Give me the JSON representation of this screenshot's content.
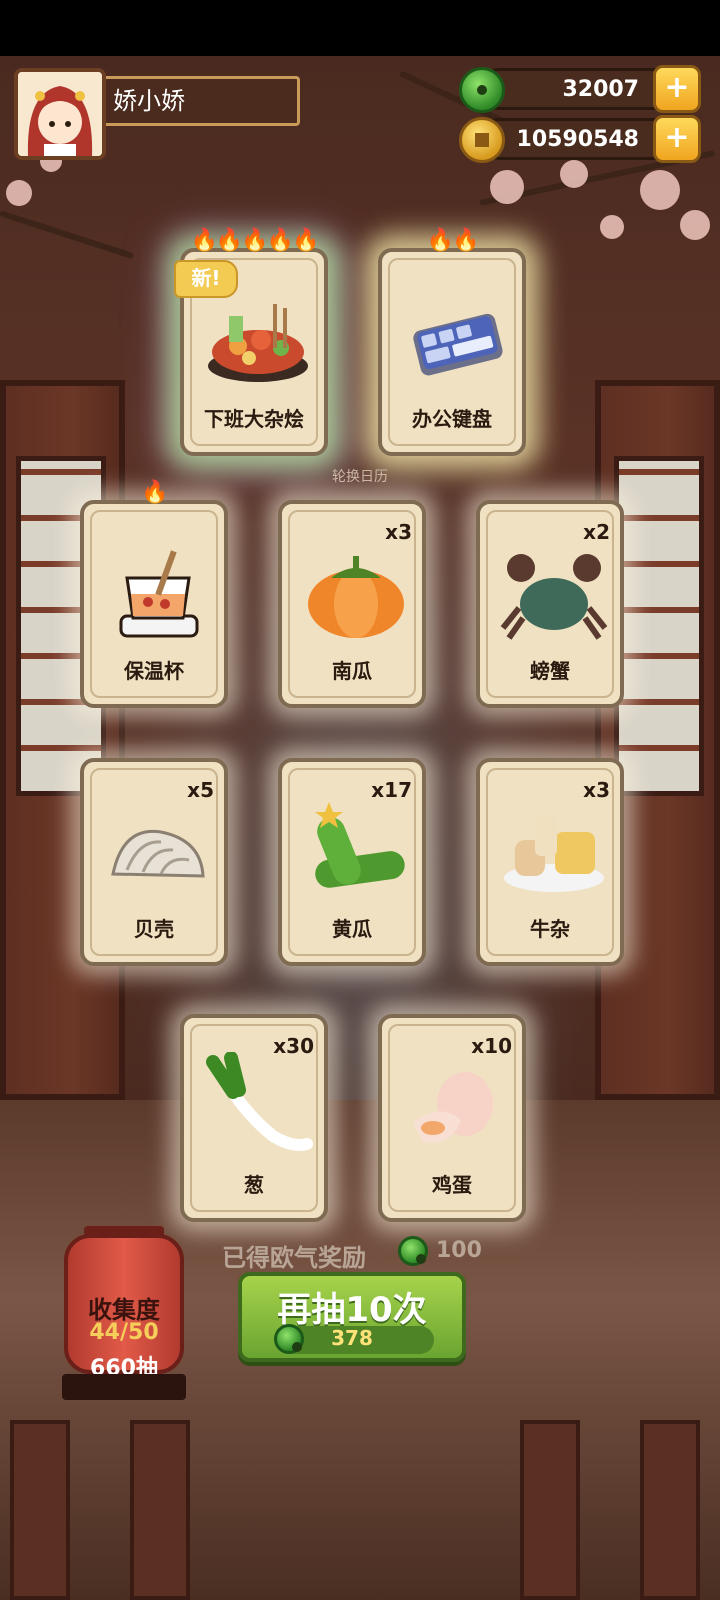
{
  "player": {
    "name": "娇小娇"
  },
  "resources": {
    "jade": {
      "value": "32007",
      "icon": "jade-icon"
    },
    "coins": {
      "value": "10590548",
      "icon": "coin-icon"
    }
  },
  "hint_text": "轮换日历",
  "featured_cards": [
    {
      "label": "下班大杂烩",
      "flames": "🔥🔥🔥🔥🔥",
      "badge": "新!",
      "icon": "hotpot-icon"
    },
    {
      "label": "办公键盘",
      "flames": "🔥🔥",
      "icon": "keyboard-icon"
    }
  ],
  "cards": [
    {
      "label": "保温杯",
      "count": "",
      "flames": "🔥",
      "icon": "thermos-cup-icon"
    },
    {
      "label": "南瓜",
      "count": "x3",
      "icon": "pumpkin-icon"
    },
    {
      "label": "螃蟹",
      "count": "x2",
      "icon": "crab-icon"
    },
    {
      "label": "贝壳",
      "count": "x5",
      "icon": "shell-icon"
    },
    {
      "label": "黄瓜",
      "count": "x17",
      "icon": "cucumber-icon"
    },
    {
      "label": "牛杂",
      "count": "x3",
      "icon": "beef-offal-icon"
    },
    {
      "label": "葱",
      "count": "x30",
      "icon": "scallion-icon"
    },
    {
      "label": "鸡蛋",
      "count": "x10",
      "icon": "egg-icon"
    }
  ],
  "collection": {
    "title": "收集度",
    "progress": "44/50",
    "draws": "660抽"
  },
  "reward": {
    "label": "已得欧气奖励",
    "value": "100"
  },
  "draw_button": {
    "label": "再抽10次",
    "cost": "378"
  },
  "colors": {
    "accent_green": "#6aa431",
    "lantern_red": "#e25a48",
    "gold": "#f0a51f"
  }
}
